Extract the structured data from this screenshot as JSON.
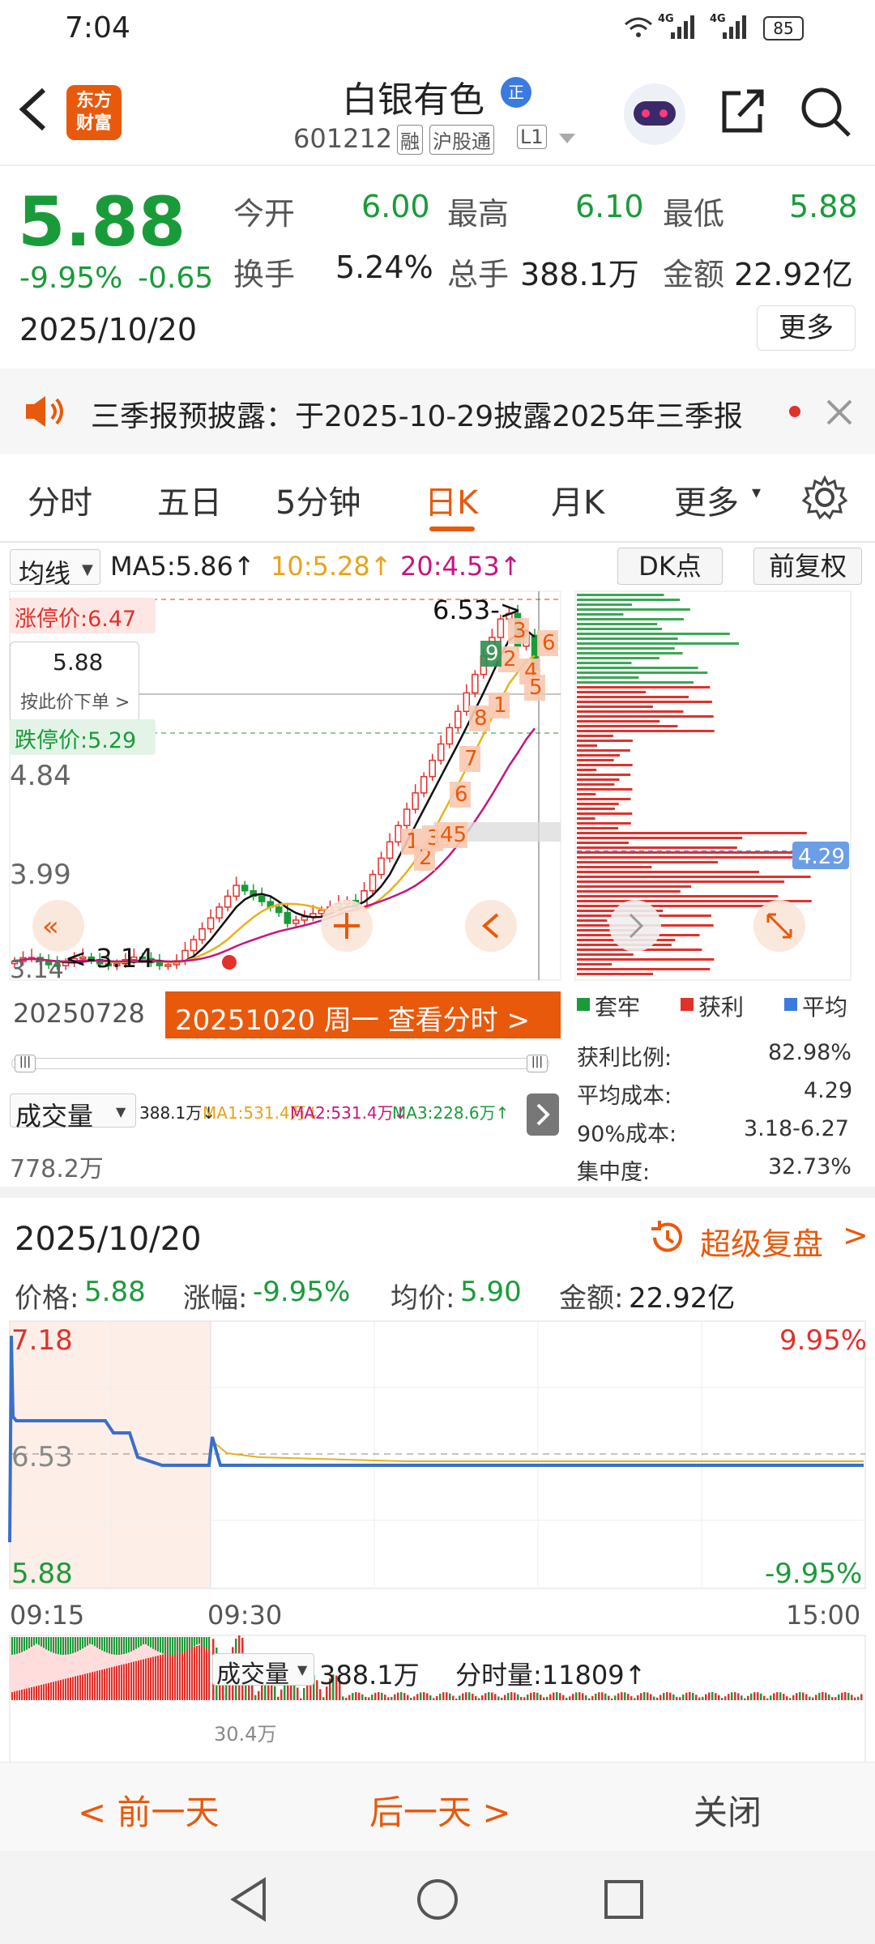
{
  "status": {
    "time": "7:04",
    "net1": "4G",
    "net2": "4G",
    "battery": "85"
  },
  "header": {
    "title": "白银有色",
    "title_badge": "正",
    "logo_line1": "东方",
    "logo_line2": "财富",
    "code": "601212",
    "tags": [
      "融",
      "沪股通",
      "L1"
    ]
  },
  "quote": {
    "price": "5.88",
    "change_pct": "-9.95%",
    "change": "-0.65",
    "date": "2025/10/20",
    "fields": [
      {
        "label": "今开",
        "value": "6.00"
      },
      {
        "label": "最高",
        "value": "6.10"
      },
      {
        "label": "最低",
        "value": "5.88"
      },
      {
        "label": "换手",
        "value": "5.24%"
      },
      {
        "label": "总手",
        "value": "388.1万"
      },
      {
        "label": "金额",
        "value": "22.92亿"
      }
    ],
    "more": "更多"
  },
  "notice": {
    "text": "三季报预披露：于2025-10-29披露2025年三季报"
  },
  "tabs": [
    "分时",
    "五日",
    "5分钟",
    "日K",
    "月K",
    "更多",
    "▾"
  ],
  "kline": {
    "ma_selector": "均线",
    "ma5": "MA5:5.86↑",
    "ma10": "10:5.28↑",
    "ma20": "20:4.53↑",
    "dk": "DK点",
    "fq": "前复权",
    "limit_up": "涨停价:6.47",
    "limit_down": "跌停价:5.29",
    "cur_price": "5.88",
    "order_hint": "按此价下单 >",
    "high_mark": "6.53->",
    "low_mark": "<-3.14",
    "y_labels": [
      "6.53",
      "4.84",
      "3.99",
      "3.14"
    ],
    "start_date": "20250728",
    "banner": "20251020 周一 查看分时 >",
    "nums": [
      "1",
      "2",
      "3",
      "45",
      "6",
      "7",
      "8",
      "1",
      "2",
      "3",
      "4",
      "5",
      "6",
      "9"
    ],
    "volume_label": "成交量",
    "vol_val": "388.1万↓",
    "vol_ma1": "MA1:531.4万↓",
    "vol_ma2": "MA2:531.4万↓",
    "vol_ma3": "MA3:228.6万↑",
    "vol_axis": "778.2万"
  },
  "chips": {
    "price_tag": "4.29",
    "legend": [
      "套牢",
      "获利",
      "平均"
    ],
    "stats": [
      {
        "label": "获利比例:",
        "value": "82.98%"
      },
      {
        "label": "平均成本:",
        "value": "4.29"
      },
      {
        "label": "90%成本:",
        "value": "3.18-6.27"
      },
      {
        "label": "集中度:",
        "value": "32.73%"
      }
    ]
  },
  "intraday": {
    "date": "2025/10/20",
    "review": "超级复盘",
    "price_label": "价格:",
    "price": "5.88",
    "chg_label": "涨幅:",
    "chg": "-9.95%",
    "avg_label": "均价:",
    "avg": "5.90",
    "amt_label": "金额:",
    "amt": "22.92亿",
    "y_top": "7.18",
    "y_mid": "6.53",
    "y_bot": "5.88",
    "pct_top": "9.95%",
    "pct_bot": "-9.95%",
    "t1": "09:15",
    "t2": "09:30",
    "t3": "15:00",
    "vol_label": "成交量",
    "vol": "388.1万",
    "fs_vol": "分时量:11809↑",
    "vol_peak": "30.4万"
  },
  "bottom": {
    "prev": "< 前一天",
    "next": "后一天 >",
    "close": "关闭"
  },
  "colors": {
    "accent": "#e8590c",
    "up": "#e0312c",
    "down": "#1a9b3a"
  }
}
